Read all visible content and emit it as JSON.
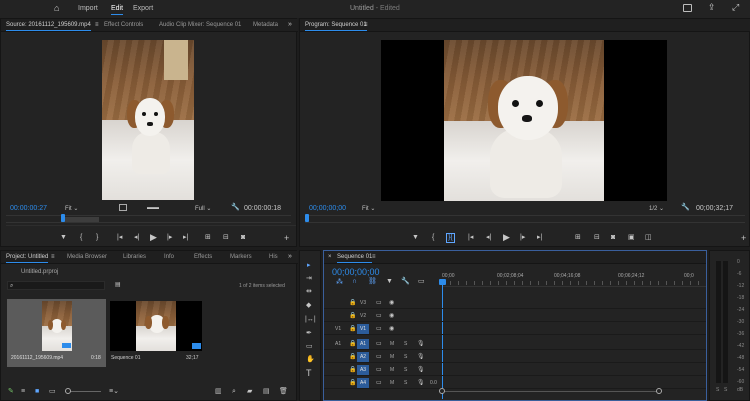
{
  "topbar": {
    "import": "Import",
    "edit": "Edit",
    "export": "Export",
    "title": "Untitled",
    "edited": "- Edited"
  },
  "source": {
    "tabs": [
      "Source: 20161112_195609.mp4",
      "Effect Controls",
      "Audio Clip Mixer: Sequence 01",
      "Metadata"
    ],
    "timecode": "00:00:00:27",
    "fit": "Fit",
    "res": "Full",
    "duration": "00:00:00:18"
  },
  "program": {
    "tab": "Program: Sequence 01",
    "timecode": "00;00;00;00",
    "fit": "Fit",
    "res": "1/2",
    "duration": "00;00;32;17"
  },
  "project": {
    "tabs": [
      "Project: Untitled",
      "Media Browser",
      "Libraries",
      "Info",
      "Effects",
      "Markers",
      "His"
    ],
    "file": "Untitled.prproj",
    "count": "1 of 2 items selected",
    "items": [
      {
        "name": "20161112_195609.mp4",
        "dur": "0:18"
      },
      {
        "name": "Sequence 01",
        "dur": "32;17"
      }
    ]
  },
  "timeline": {
    "tab": "Sequence 01",
    "timecode": "00;00;00;00",
    "ruler": [
      "00;00",
      "00;02;08;04",
      "00;04;16;08",
      "00;06;24;12",
      "00;0"
    ],
    "video_tracks": [
      "V3",
      "V2",
      "V1"
    ],
    "audio_tracks": [
      "A1",
      "A2",
      "A3",
      "A4"
    ],
    "v1_src": "V1",
    "a1_src": "A1",
    "m": "M",
    "s": "S",
    "vol": "0.0"
  },
  "meter": {
    "ticks": [
      "0",
      "-6",
      "-12",
      "-18",
      "-24",
      "-30",
      "-36",
      "-42",
      "-48",
      "-54",
      "-60"
    ],
    "bottom": "dB",
    "solo": "S"
  }
}
